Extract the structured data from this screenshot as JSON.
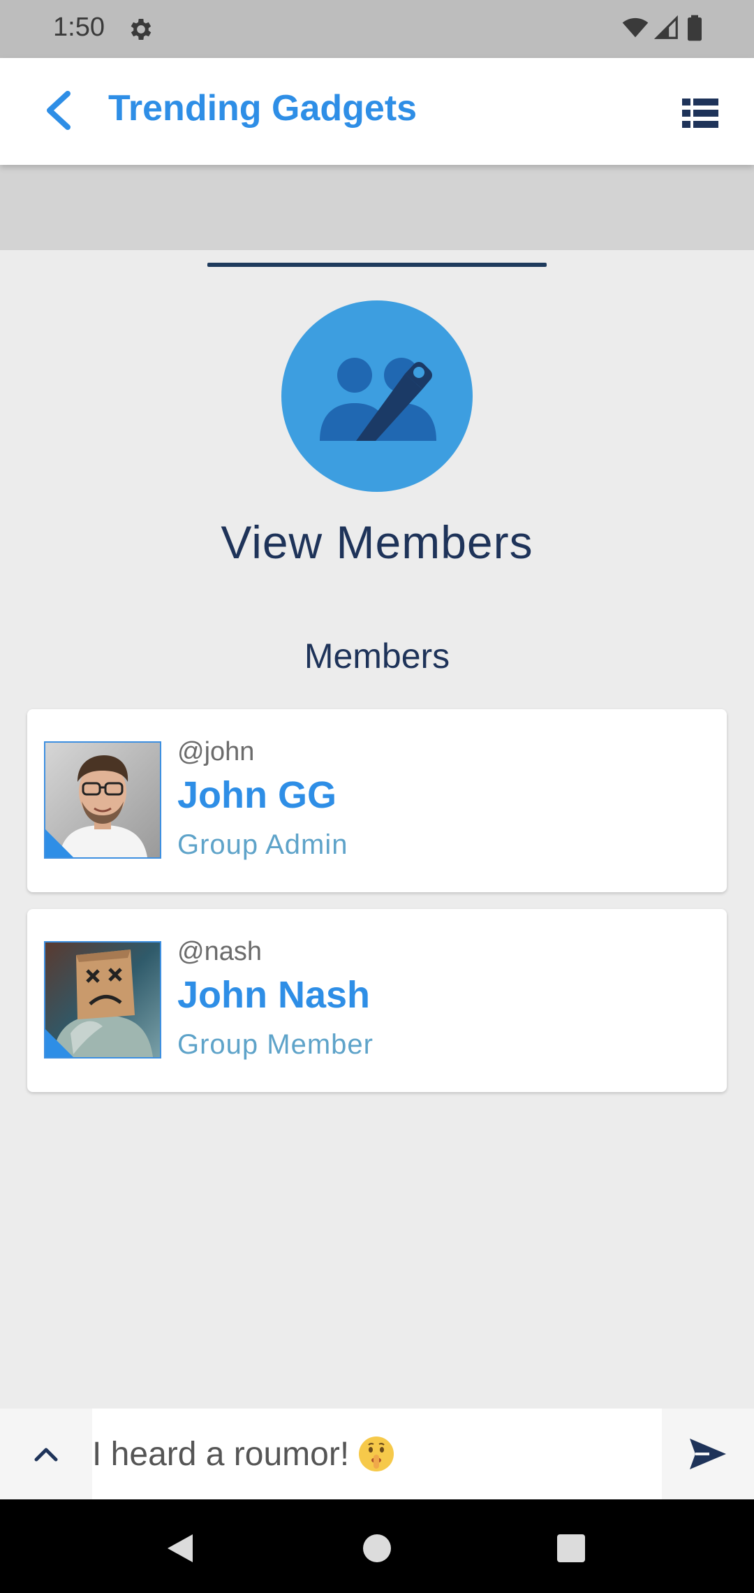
{
  "status_bar": {
    "time": "1:50",
    "icons": [
      "gear-icon",
      "wifi-icon",
      "signal-icon",
      "battery-icon"
    ]
  },
  "app_bar": {
    "title": "Trending Gadgets",
    "back_icon": "chevron-left-icon",
    "menu_icon": "list-icon"
  },
  "sheet": {
    "icon": "group-edit-icon",
    "title": "View Members",
    "section_label": "Members"
  },
  "members": [
    {
      "handle": "@john",
      "name": "John GG",
      "role": "Group Admin"
    },
    {
      "handle": "@nash",
      "name": "John Nash",
      "role": "Group Member"
    }
  ],
  "composer": {
    "message": "I heard a roumor!",
    "emoji": "shushing-face-emoji",
    "expand_icon": "chevron-up-icon",
    "send_icon": "send-icon"
  },
  "nav_bar": {
    "icons": [
      "back-triangle-icon",
      "home-circle-icon",
      "recents-square-icon"
    ]
  },
  "colors": {
    "accent": "#2e8ee6",
    "dark_navy": "#1e3359",
    "role_text": "#5ea3c9",
    "hero_circle": "#3d9ee0"
  }
}
